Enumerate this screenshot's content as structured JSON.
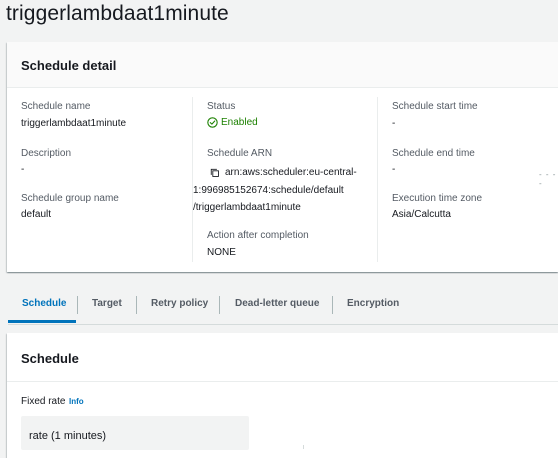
{
  "page": {
    "title": "triggerlambdaat1minute"
  },
  "detail": {
    "title": "Schedule detail",
    "schedule_name": {
      "label": "Schedule name",
      "value": "triggerlambdaat1minute"
    },
    "description": {
      "label": "Description",
      "value": "-"
    },
    "schedule_group": {
      "label": "Schedule group name",
      "value": "default"
    },
    "status": {
      "label": "Status",
      "value": "Enabled",
      "icon": "check-circle-icon",
      "color": "#1d8102"
    },
    "arn": {
      "label": "Schedule ARN",
      "line1": "arn:aws:scheduler:eu-central-",
      "line2": "1:996985152674:schedule/default",
      "line3": "/triggerlambdaat1minute",
      "icon": "copy-icon"
    },
    "action_after_completion": {
      "label": "Action after completion",
      "value": "NONE"
    },
    "start_time": {
      "label": "Schedule start time",
      "value": "-"
    },
    "end_time": {
      "label": "Schedule end time",
      "value": "-"
    },
    "timezone": {
      "label": "Execution time zone",
      "value": "Asia/Calcutta"
    }
  },
  "tabs": {
    "active": "Schedule",
    "items": [
      "Schedule",
      "Target",
      "Retry policy",
      "Dead-letter queue",
      "Encryption"
    ]
  },
  "schedule": {
    "title": "Schedule",
    "fixed_rate_label": "Fixed rate",
    "info_link": "Info",
    "rate_value": "rate (1 minutes)"
  },
  "colors": {
    "accent": "#0073bb",
    "success": "#1d8102",
    "background": "#f2f3f3"
  }
}
